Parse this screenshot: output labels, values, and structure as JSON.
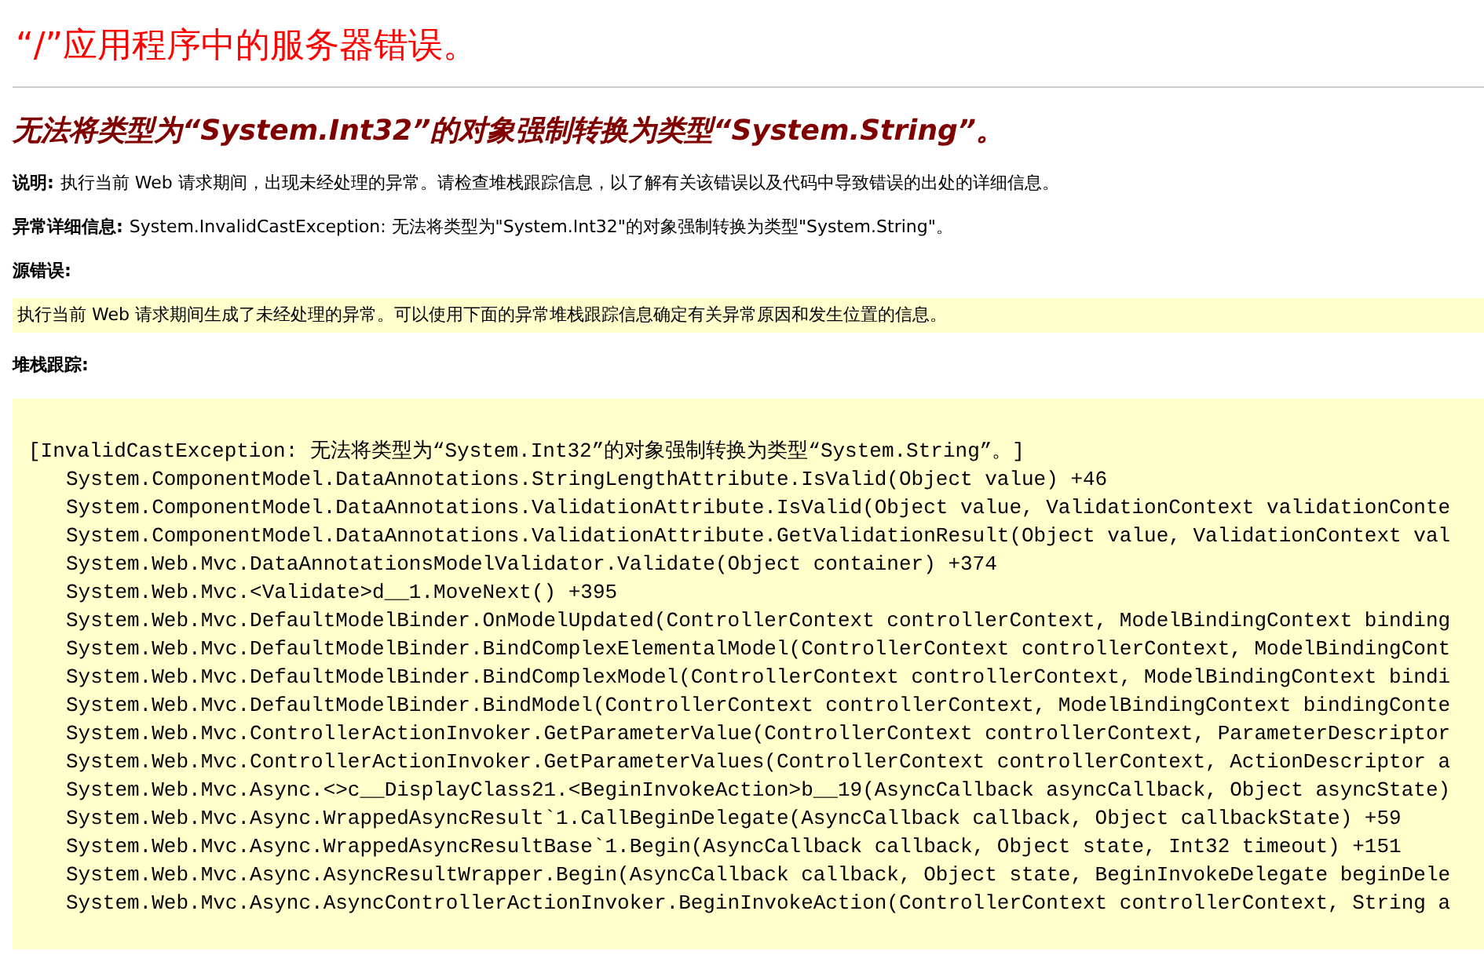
{
  "title": "“/”应用程序中的服务器错误。",
  "subtitle": "无法将类型为“System.Int32”的对象强制转换为类型“System.String”。",
  "description": {
    "label": "说明:",
    "text": "执行当前 Web 请求期间，出现未经处理的异常。请检查堆栈跟踪信息，以了解有关该错误以及代码中导致错误的出处的详细信息。"
  },
  "exception_details": {
    "label": "异常详细信息:",
    "text": "System.InvalidCastException: 无法将类型为\"System.Int32\"的对象强制转换为类型\"System.String\"。"
  },
  "source_error": {
    "label": "源错误:",
    "text": "执行当前 Web 请求期间生成了未经处理的异常。可以使用下面的异常堆栈跟踪信息确定有关异常原因和发生位置的信息。"
  },
  "stack_trace": {
    "label": "堆栈跟踪:",
    "header": "[InvalidCastException: 无法将类型为“System.Int32”的对象强制转换为类型“System.String”。]",
    "lines": [
      "System.ComponentModel.DataAnnotations.StringLengthAttribute.IsValid(Object value) +46",
      "System.ComponentModel.DataAnnotations.ValidationAttribute.IsValid(Object value, ValidationContext validationConte",
      "System.ComponentModel.DataAnnotations.ValidationAttribute.GetValidationResult(Object value, ValidationContext val",
      "System.Web.Mvc.DataAnnotationsModelValidator.Validate(Object container) +374",
      "System.Web.Mvc.<Validate>d__1.MoveNext() +395",
      "System.Web.Mvc.DefaultModelBinder.OnModelUpdated(ControllerContext controllerContext, ModelBindingContext binding",
      "System.Web.Mvc.DefaultModelBinder.BindComplexElementalModel(ControllerContext controllerContext, ModelBindingCont",
      "System.Web.Mvc.DefaultModelBinder.BindComplexModel(ControllerContext controllerContext, ModelBindingContext bindi",
      "System.Web.Mvc.DefaultModelBinder.BindModel(ControllerContext controllerContext, ModelBindingContext bindingConte",
      "System.Web.Mvc.ControllerActionInvoker.GetParameterValue(ControllerContext controllerContext, ParameterDescriptor",
      "System.Web.Mvc.ControllerActionInvoker.GetParameterValues(ControllerContext controllerContext, ActionDescriptor a",
      "System.Web.Mvc.Async.<>c__DisplayClass21.<BeginInvokeAction>b__19(AsyncCallback asyncCallback, Object asyncState)",
      "System.Web.Mvc.Async.WrappedAsyncResult`1.CallBeginDelegate(AsyncCallback callback, Object callbackState) +59",
      "System.Web.Mvc.Async.WrappedAsyncResultBase`1.Begin(AsyncCallback callback, Object state, Int32 timeout) +151",
      "System.Web.Mvc.Async.AsyncResultWrapper.Begin(AsyncCallback callback, Object state, BeginInvokeDelegate beginDele",
      "System.Web.Mvc.Async.AsyncControllerActionInvoker.BeginInvokeAction(ControllerContext controllerContext, String a"
    ]
  }
}
